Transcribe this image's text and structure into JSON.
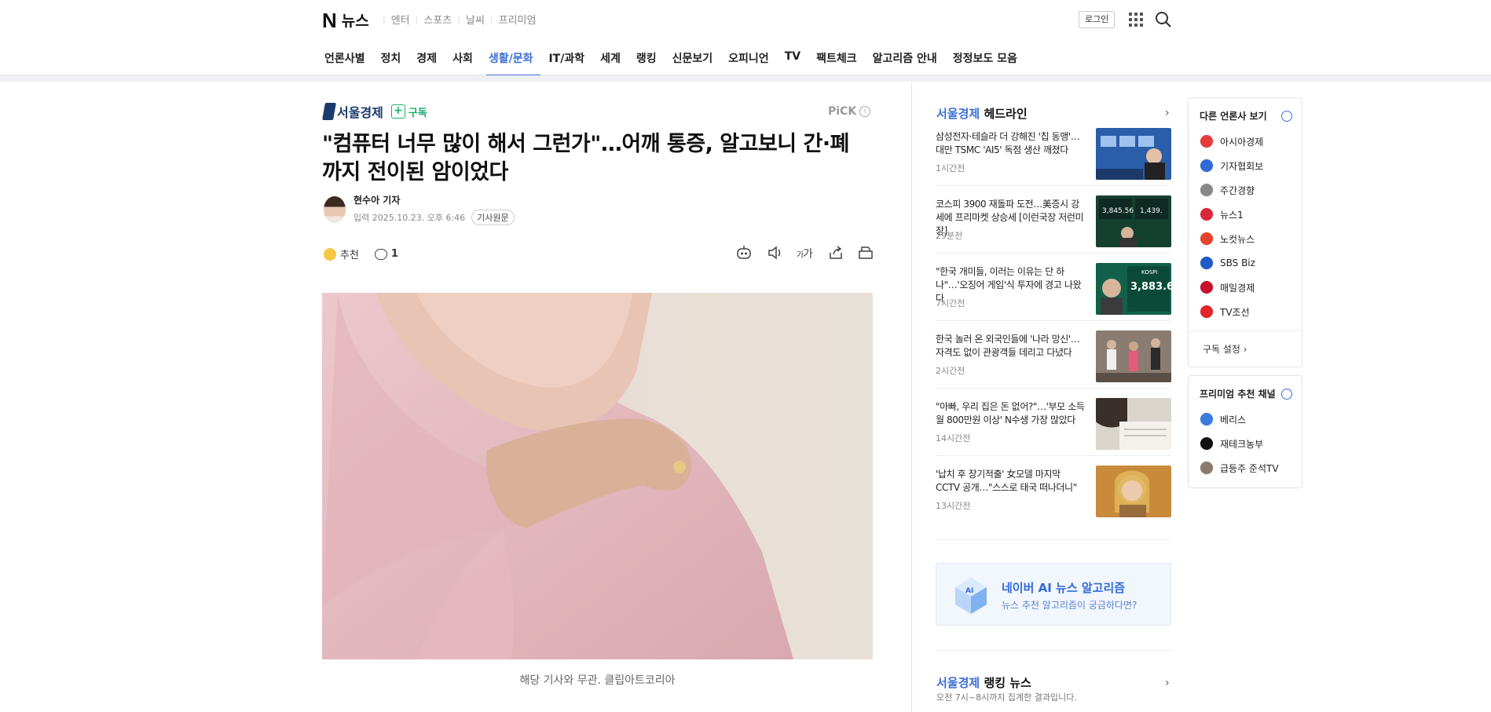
{
  "header": {
    "logo_n": "N",
    "logo_title": "뉴스",
    "services": [
      "엔터",
      "스포츠",
      "날씨",
      "프리미엄"
    ],
    "login": "로그인"
  },
  "nav": [
    "언론사별",
    "정치",
    "경제",
    "사회",
    "생활/문화",
    "IT/과학",
    "세계",
    "랭킹",
    "신문보기",
    "오피니언",
    "TV",
    "팩트체크",
    "알고리즘 안내",
    "정정보도 모음"
  ],
  "article": {
    "press": "서울경제",
    "subscribe": "구독",
    "pick": "PiCK",
    "title_line1": "\"컴퓨터 너무 많이 해서 그런가\"…어깨 통증, 알고보니 간·폐",
    "title_line2": "까지 전이된 암이었다",
    "reporter": "현수아 기자",
    "date": "입력 2025.10.23. 오후 6:46",
    "original": "기사원문",
    "like": "추천",
    "comments": "1",
    "caption": "해당 기사와 무관. 클립아트코리아"
  },
  "headlines": {
    "brand": "서울경제",
    "label": "헤드라인",
    "items": [
      {
        "title": "삼성전자·테슬라 더 강해진 '칩 동맹'…대만 TSMC 'AI5' 독점 생산 깨졌다",
        "ago": "1시간전"
      },
      {
        "title": "코스피 3900 재돌파 도전…美증시 강세에 프리마켓 상승세 [이런국장 저런미장]",
        "ago": "29분전"
      },
      {
        "title": "\"한국 개미들, 이러는 이유는 단 하나\"…'오징어 게임'식 투자에 경고 나왔다",
        "ago": "7시간전"
      },
      {
        "title": "한국 놀러 온 외국인들에 '나라 망신'…자격도 없이 관광객들 데리고 다녔다",
        "ago": "2시간전"
      },
      {
        "title": "\"아빠, 우리 집은 돈 없어?\"…'부모 소득 월 800만원 이상' N수생 가장 많았다",
        "ago": "14시간전"
      },
      {
        "title": "'납치 후 장기적출' 女모델 마지막 CCTV 공개…\"스스로 태국 떠나더니\"",
        "ago": "13시간전"
      }
    ]
  },
  "ai_box": {
    "title": "네이버 AI 뉴스 알고리즘",
    "subtitle": "뉴스 추천 알고리즘이 궁금하다면?"
  },
  "ranking": {
    "brand": "서울경제",
    "label": "랭킹 뉴스",
    "subtitle": "오전 7시~8시까지 집계한 결과입니다."
  },
  "other_press": {
    "title": "다른 언론사 보기",
    "items": [
      {
        "name": "아시아경제",
        "color": "#e63b3b"
      },
      {
        "name": "기자협회보",
        "color": "#2e6bd6"
      },
      {
        "name": "주간경향",
        "color": "#888888"
      },
      {
        "name": "뉴스1",
        "color": "#d9263a"
      },
      {
        "name": "노컷뉴스",
        "color": "#e5432e"
      },
      {
        "name": "SBS Biz",
        "color": "#1e5bc6"
      },
      {
        "name": "매일경제",
        "color": "#c8102e"
      },
      {
        "name": "TV조선",
        "color": "#e3222b"
      }
    ],
    "settings": "구독 설정"
  },
  "premium": {
    "title": "프리미엄 추천 채널",
    "items": [
      {
        "name": "베리스",
        "color": "#3a7be0"
      },
      {
        "name": "재테크농부",
        "color": "#111111"
      },
      {
        "name": "급등주 준석TV",
        "color": "#8a7a6e"
      }
    ]
  }
}
